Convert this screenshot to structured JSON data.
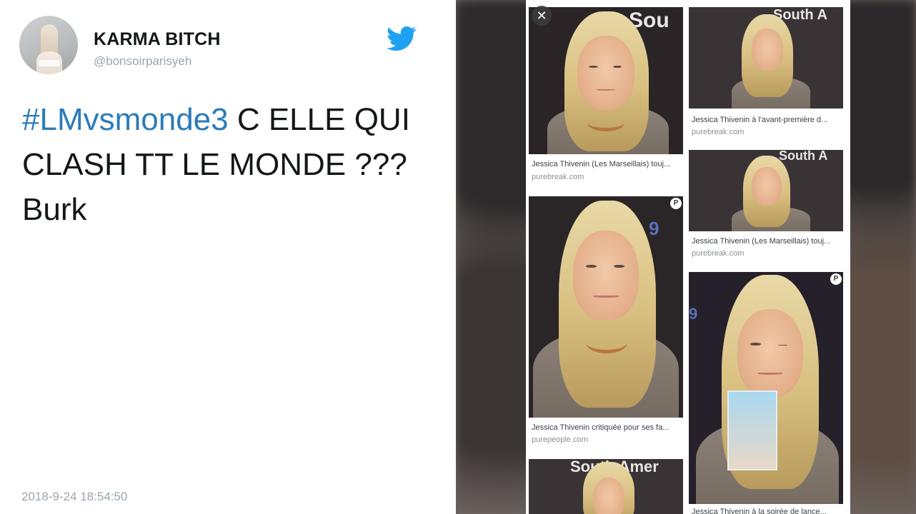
{
  "tweet": {
    "display_name": "KARMA BITCH",
    "handle": "@bonsoirparisyeh",
    "hashtag": "#LMvsmonde3",
    "text_after_hashtag": " C ELLE QUI CLASH TT LE MONDE ??? Burk",
    "timestamp": "2018-9-24 18:54:50",
    "icons": {
      "brand": "twitter-bird-icon"
    },
    "colors": {
      "hashtag": "#2b7bb9",
      "brand": "#1da1f2"
    }
  },
  "image_results": {
    "close_label": "✕",
    "cards": [
      {
        "caption": "Jessica Thivenin (Les Marseillais) touj...",
        "source": "purebreak.com",
        "bg_text": "Sou",
        "badge": ""
      },
      {
        "caption": "Jessica Thivenin à l'avant-première d...",
        "source": "purebreak.com",
        "bg_text": "South A",
        "badge": ""
      },
      {
        "caption": "Jessica Thivenin (Les Marseillais) touj...",
        "source": "purebreak.com",
        "bg_text": "South A",
        "badge": ""
      },
      {
        "caption": "Jessica Thivenin critiquée pour ses fa...",
        "source": "purepeople.com",
        "bg_text": "9",
        "badge": "P"
      },
      {
        "caption": "Jessica Thivenin à la soirée de lance...",
        "source": "",
        "bg_text": "9",
        "badge": "P"
      },
      {
        "caption": "",
        "source": "",
        "bg_text": "South Amer",
        "badge": ""
      }
    ]
  }
}
